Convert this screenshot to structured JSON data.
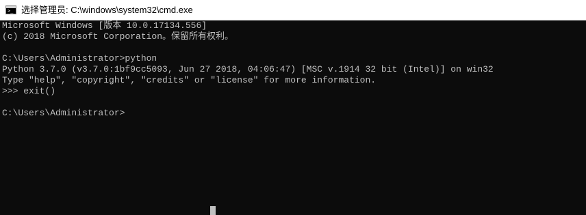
{
  "window": {
    "title": "选择管理员: C:\\windows\\system32\\cmd.exe",
    "icon": "cmd-icon"
  },
  "console": {
    "lines": [
      "Microsoft Windows [版本 10.0.17134.556]",
      "(c) 2018 Microsoft Corporation。保留所有权利。",
      "",
      "C:\\Users\\Administrator>python",
      "Python 3.7.0 (v3.7.0:1bf9cc5093, Jun 27 2018, 04:06:47) [MSC v.1914 32 bit (Intel)] on win32",
      "Type \"help\", \"copyright\", \"credits\" or \"license\" for more information.",
      ">>> exit()",
      "",
      "C:\\Users\\Administrator>"
    ]
  },
  "colors": {
    "console_background": "#0c0c0c",
    "console_text": "#c0c0c0",
    "titlebar_background": "#ffffff"
  }
}
